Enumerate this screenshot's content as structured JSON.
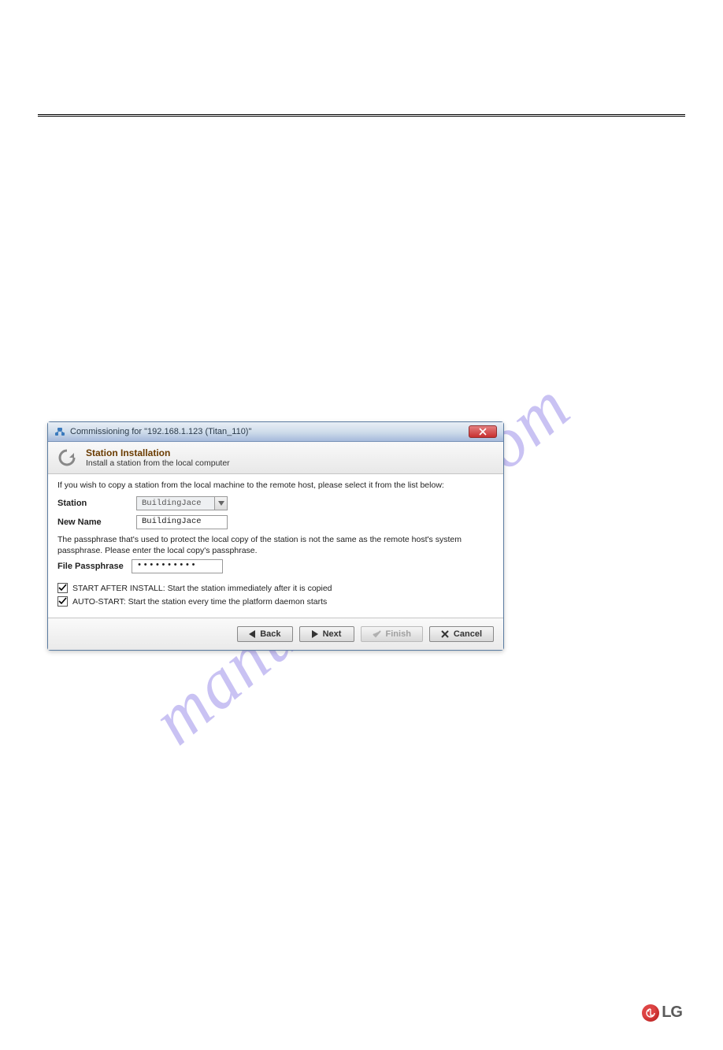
{
  "watermark": "manualshive.com",
  "dialog": {
    "title": "Commissioning for \"192.168.1.123 (Titan_110)\"",
    "header": {
      "title": "Station Installation",
      "subtitle": "Install a station from the local computer"
    },
    "intro": "If you wish to copy a station from the local machine to the remote host, please select it from the list below:",
    "fields": {
      "station": {
        "label": "Station",
        "value": "BuildingJace"
      },
      "newName": {
        "label": "New Name",
        "value": "BuildingJace"
      },
      "filePassphrase": {
        "label": "File Passphrase",
        "value": "••••••••••"
      }
    },
    "note": "The passphrase that's used to protect the local copy of the station is not the same as the remote host's system passphrase. Please enter the local copy's passphrase.",
    "checkboxes": {
      "startAfterInstall": "START AFTER INSTALL: Start the station immediately after it is copied",
      "autoStart": "AUTO-START: Start the station every time the platform daemon starts"
    },
    "buttons": {
      "back": "Back",
      "next": "Next",
      "finish": "Finish",
      "cancel": "Cancel"
    }
  },
  "logo": {
    "text": "LG"
  }
}
